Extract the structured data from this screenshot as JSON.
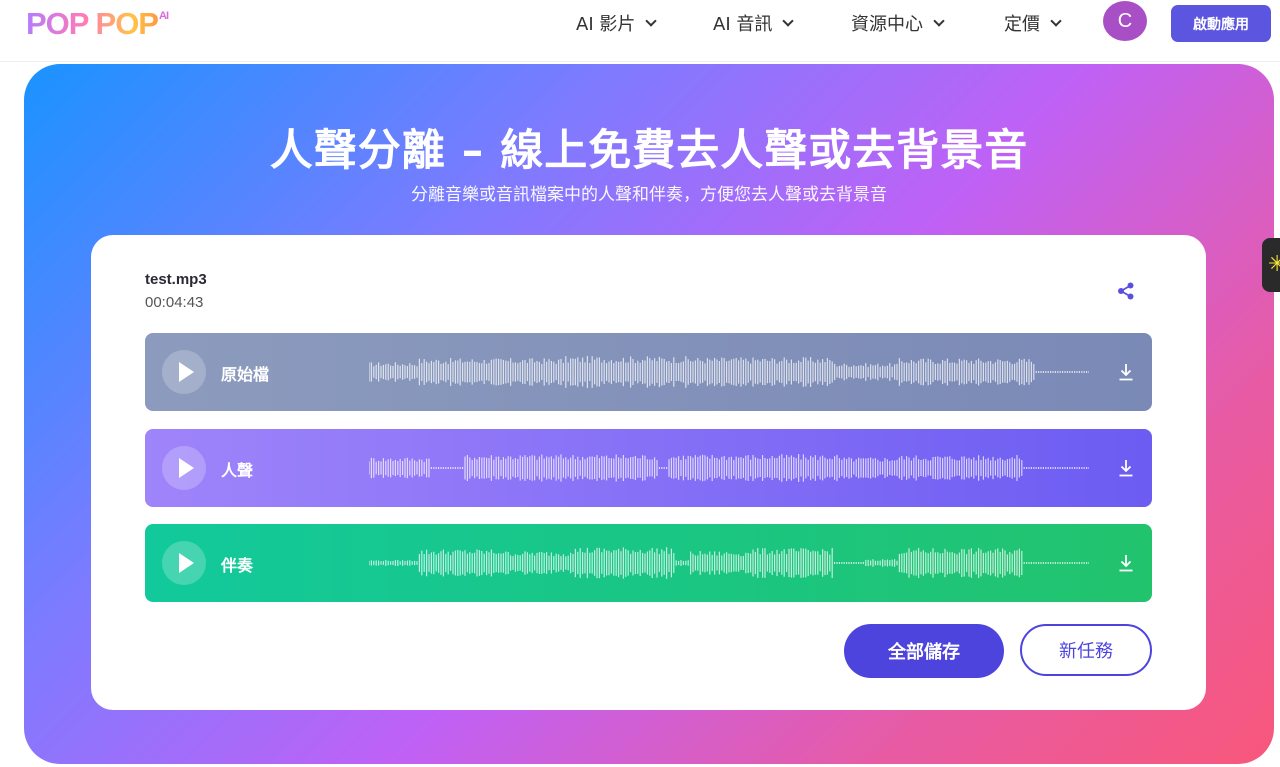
{
  "brand": {
    "logo_text": "POP POP",
    "logo_sup": "AI"
  },
  "nav": {
    "items": [
      {
        "label": "AI 影片"
      },
      {
        "label": "AI 音訊"
      },
      {
        "label": "資源中心"
      },
      {
        "label": "定價"
      }
    ],
    "avatar_initial": "C",
    "launch_label": "啟動應用"
  },
  "hero": {
    "title": "人聲分離 – 線上免費去人聲或去背景音",
    "subtitle": "分離音樂或音訊檔案中的人聲和伴奏，方便您去人聲或去背景音"
  },
  "file": {
    "name": "test.mp3",
    "duration": "00:04:43"
  },
  "tracks": [
    {
      "label": "原始檔",
      "color": "#8592ba"
    },
    {
      "label": "人聲",
      "color": "#7f6ff5"
    },
    {
      "label": "伴奏",
      "color": "#19c587"
    }
  ],
  "actions": {
    "save_all": "全部儲存",
    "new_task": "新任務"
  },
  "icons": {
    "share": "share-icon",
    "download": "download-icon",
    "play": "play-icon",
    "chevron": "chevron-down-icon"
  }
}
